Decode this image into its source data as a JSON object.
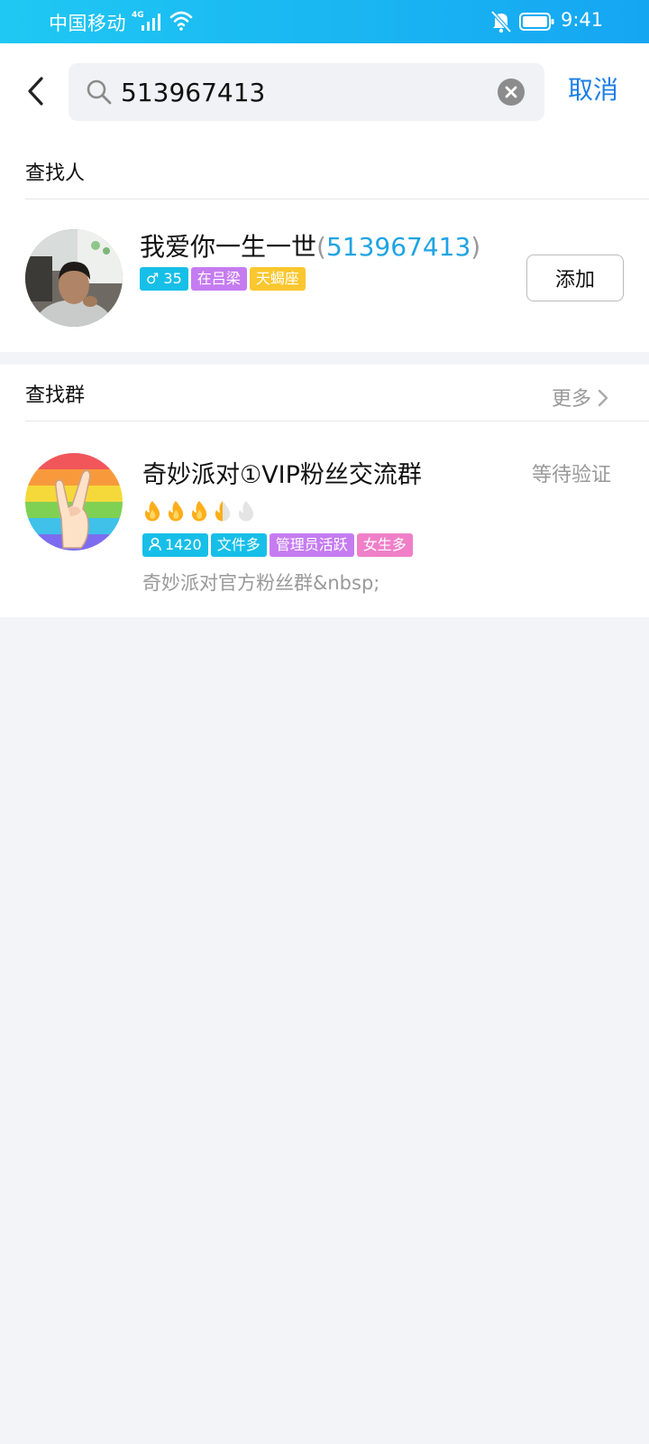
{
  "status_bar": {
    "carrier": "中国移动",
    "network": "4G",
    "time": "9:41",
    "icons": [
      "signal-icon",
      "wifi-icon",
      "mute-bell-icon",
      "battery-icon"
    ]
  },
  "search": {
    "value": "513967413",
    "cancel_label": "取消",
    "icons": [
      "back-arrow-icon",
      "search-icon",
      "clear-icon"
    ]
  },
  "person_section": {
    "title": "查找人",
    "result": {
      "name": "我爱你一生一世",
      "open_paren": "(",
      "qq": "513967413",
      "close_paren": ")",
      "tags": [
        {
          "label": "♂ 35",
          "color": "#17bfe8"
        },
        {
          "label": "在吕梁",
          "color": "#c57cf0"
        },
        {
          "label": "天蝎座",
          "color": "#fbc72f"
        }
      ],
      "add_label": "添加"
    }
  },
  "group_section": {
    "title": "查找群",
    "more_label": "更多",
    "result": {
      "name": "奇妙派对①VIP粉丝交流群",
      "status": "等待验证",
      "activity_level": 3.5,
      "activity_max": 5,
      "tags": [
        {
          "label": "1420",
          "color": "#17bfe8",
          "icon": "person-icon"
        },
        {
          "label": "文件多",
          "color": "#17bfe8"
        },
        {
          "label": "管理员活跃",
          "color": "#c57cf0"
        },
        {
          "label": "女生多",
          "color": "#f07fc8"
        }
      ],
      "description": "奇妙派对官方粉丝群&nbsp;"
    }
  },
  "colors": {
    "accent_blue": "#1a7ee6",
    "qq_blue": "#1ea4e3",
    "page_bg": "#f2f4f8",
    "status_bar_start": "#1fc8f3",
    "status_bar_end": "#15a6f2"
  }
}
